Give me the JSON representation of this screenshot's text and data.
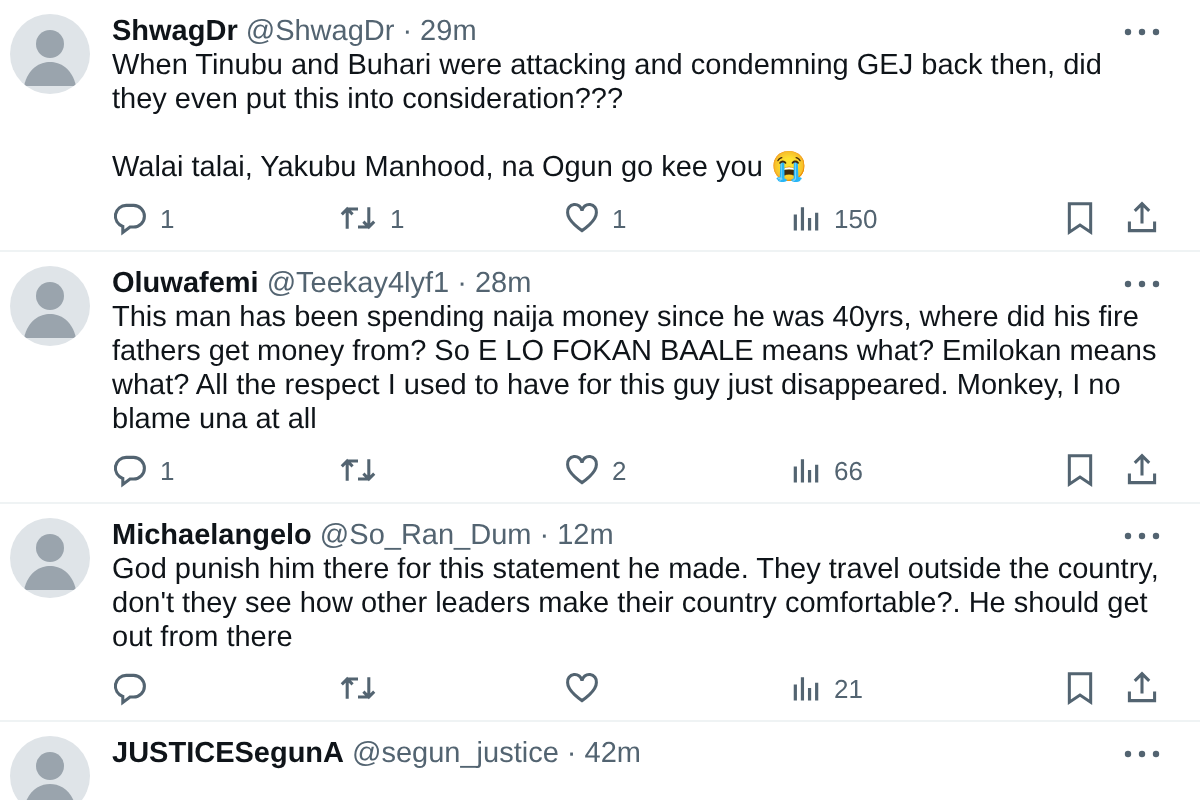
{
  "tweets": [
    {
      "name": "ShwagDr",
      "handle": "@ShwagDr",
      "time": "· 29m",
      "paragraphs": [
        "When Tinubu and Buhari were attacking and condemning GEJ back then, did they even put this into consideration???",
        "Walai talai, Yakubu Manhood, na Ogun go kee you 😭"
      ],
      "replies": "1",
      "reposts": "1",
      "likes": "1",
      "views": "150"
    },
    {
      "name": "Oluwafemi",
      "handle": "@Teekay4lyf1",
      "time": "· 28m",
      "paragraphs": [
        "This man has been spending naija money since he was 40yrs, where did his fire fathers get money from? So E LO FOKAN BAALE means what? Emilokan means what? All the respect I used to have for this guy just disappeared. Monkey, I no blame una at all"
      ],
      "replies": "1",
      "likes": "2",
      "views": "66"
    },
    {
      "name": "Michaelangelo",
      "handle": "@So_Ran_Dum",
      "time": "· 12m",
      "paragraphs": [
        "God punish him there for this statement he made. They travel outside the country, don't they see how other leaders make their country comfortable?. He should get out from there"
      ],
      "views": "21"
    },
    {
      "name": "JUSTICESegunA",
      "handle": "@segun_justice",
      "time": "· 42m"
    }
  ]
}
